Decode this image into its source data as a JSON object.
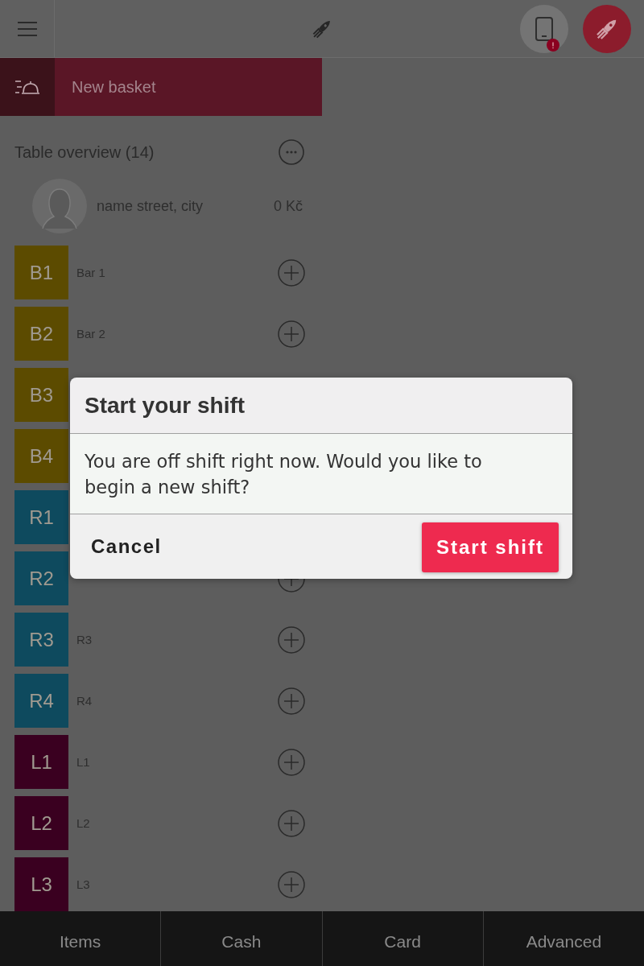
{
  "tablet_button": {
    "alert": true
  },
  "basket_bar": {
    "label": "New basket"
  },
  "table_overview": {
    "title": "Table overview (14)"
  },
  "customer": {
    "name": "name street, city",
    "amount": "0 Kč"
  },
  "tables": [
    {
      "code": "B1",
      "name": "Bar 1",
      "add_button": true,
      "color": "#5c4b00"
    },
    {
      "code": "B2",
      "name": "Bar 2",
      "add_button": true,
      "color": "#5c4b00"
    },
    {
      "code": "B3",
      "color": "#5c4b00"
    },
    {
      "code": "B4",
      "color": "#5c4b00"
    },
    {
      "code": "R1",
      "color": "#0e4a5e"
    },
    {
      "code": "R2",
      "add_button": true,
      "color": "#0e4a5e"
    },
    {
      "code": "R3",
      "name": "R3",
      "add_button": true,
      "color": "#0e4a5e"
    },
    {
      "code": "R4",
      "name": "R4",
      "add_button": true,
      "color": "#0e4a5e"
    },
    {
      "code": "L1",
      "name": "L1",
      "add_button": true,
      "color": "#3a0020"
    },
    {
      "code": "L2",
      "name": "L2",
      "add_button": true,
      "color": "#3a0020"
    },
    {
      "code": "L3",
      "name": "L3",
      "add_button": true,
      "color": "#3a0020"
    }
  ],
  "dialog": {
    "title": "Start your shift",
    "message": "You are off shift right now. Would you like to begin a new shift?",
    "cancel": "Cancel",
    "confirm": "Start shift"
  },
  "bottom_tabs": [
    "Items",
    "Cash",
    "Card",
    "Advanced"
  ]
}
